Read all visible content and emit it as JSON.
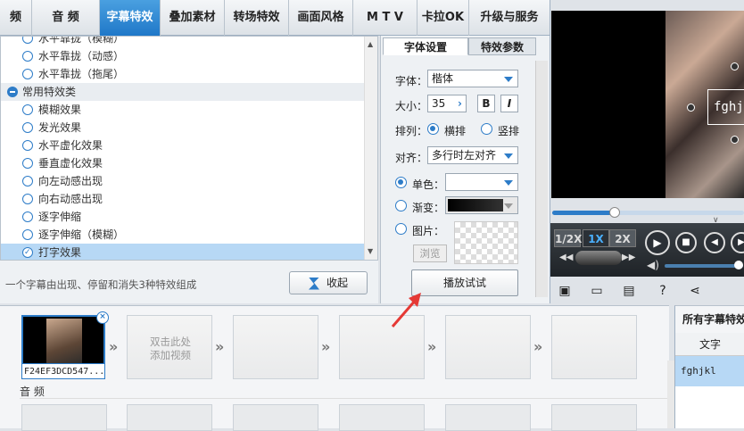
{
  "tabs": [
    {
      "label": "频",
      "active": false
    },
    {
      "label": "音 频",
      "active": false
    },
    {
      "label": "字幕特效",
      "active": true
    },
    {
      "label": "叠加素材",
      "active": false
    },
    {
      "label": "转场特效",
      "active": false
    },
    {
      "label": "画面风格",
      "active": false
    },
    {
      "label": "M T V",
      "active": false
    },
    {
      "label": "卡拉OK",
      "active": false
    },
    {
      "label": "升级与服务",
      "active": false
    }
  ],
  "effect_list": [
    {
      "label": "水平靠拢（模糊）",
      "type": "item"
    },
    {
      "label": "水平靠拢（动感）",
      "type": "item"
    },
    {
      "label": "水平靠拢（拖尾）",
      "type": "item"
    },
    {
      "label": "常用特效类",
      "type": "category"
    },
    {
      "label": "模糊效果",
      "type": "item"
    },
    {
      "label": "发光效果",
      "type": "item"
    },
    {
      "label": "水平虚化效果",
      "type": "item"
    },
    {
      "label": "垂直虚化效果",
      "type": "item"
    },
    {
      "label": "向左动感出现",
      "type": "item"
    },
    {
      "label": "向右动感出现",
      "type": "item"
    },
    {
      "label": "逐字伸缩",
      "type": "item"
    },
    {
      "label": "逐字伸缩（模糊）",
      "type": "item"
    },
    {
      "label": "打字效果",
      "type": "selected"
    }
  ],
  "left_bottom": {
    "hint": "一个字幕由出现、停留和消失3种特效组成",
    "collapse_label": "收起"
  },
  "settings": {
    "tab_font": "字体设置",
    "tab_effect": "特效参数",
    "font_label": "字体：",
    "font_value": "楷体",
    "size_label": "大小：",
    "size_value": "35",
    "bold": "B",
    "italic": "I",
    "layout_label": "排列：",
    "layout_h": "横排",
    "layout_v": "竖排",
    "align_label": "对齐：",
    "align_value": "多行时左对齐",
    "solid_label": "单色：",
    "gradient_label": "渐变：",
    "image_label": "图片：",
    "browse_label": "浏览",
    "play_test_label": "播放试试"
  },
  "preview": {
    "subtitle_text": "fghj",
    "speeds": [
      "1/2X",
      "1X",
      "2X"
    ],
    "active_speed": "1X"
  },
  "timeline": {
    "clip1_name": "F24EF3DCD547...",
    "empty_hint_1": "双击此处",
    "empty_hint_2": "添加视频",
    "audio_label": "音 频"
  },
  "subtitle_panel": {
    "title": "所有字幕特效",
    "column": "文字",
    "row_text": "fghjkl"
  },
  "colors": {
    "accent": "#2d7cc8",
    "selection": "#b7d8f5",
    "annotation": "#e53935"
  }
}
